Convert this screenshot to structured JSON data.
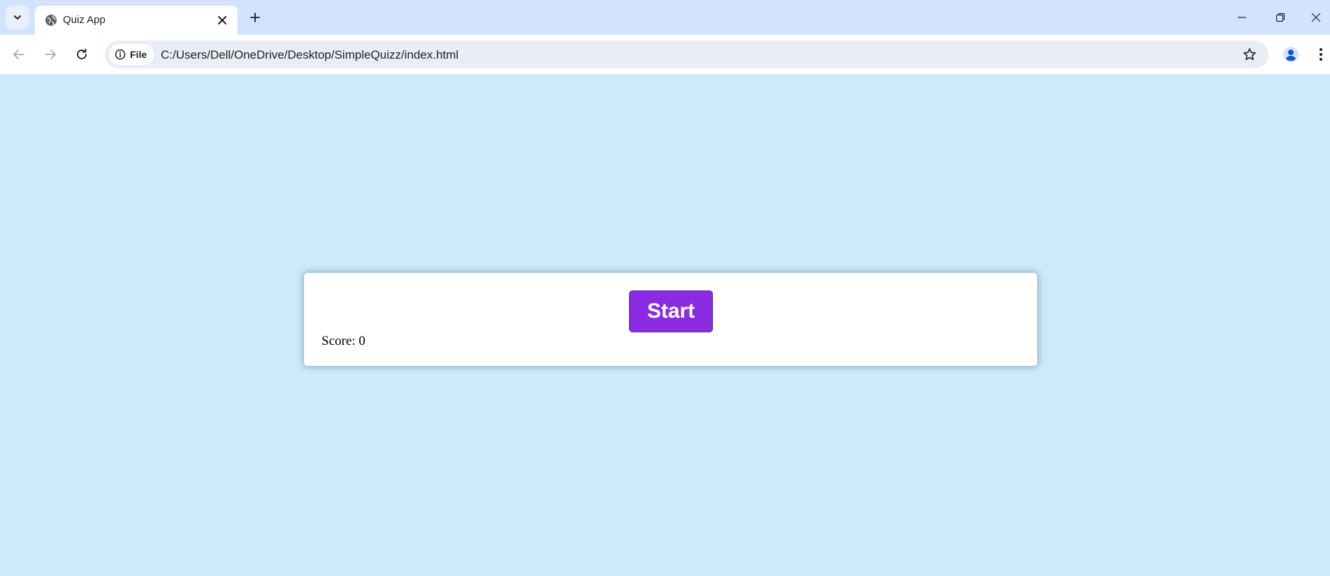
{
  "browser": {
    "tab": {
      "title": "Quiz App",
      "favicon": "globe-icon"
    },
    "address_bar": {
      "site_chip_label": "File",
      "url": "C:/Users/Dell/OneDrive/Desktop/SimpleQuizz/index.html"
    },
    "icons": {
      "tab_search": "chevron-down-icon",
      "tab_close": "close-icon",
      "new_tab": "plus-icon",
      "minimize": "minimize-icon",
      "restore": "restore-icon",
      "close_window": "close-icon",
      "back": "arrow-left-icon",
      "forward": "arrow-right-icon",
      "reload": "reload-icon",
      "info": "info-icon",
      "bookmark": "star-icon",
      "profile": "person-icon",
      "menu": "kebab-menu-icon"
    }
  },
  "page": {
    "background_color": "#cdeafd",
    "quiz": {
      "start_label": "Start",
      "start_color": "#8a2be2",
      "score_text": "Score: 0"
    }
  }
}
